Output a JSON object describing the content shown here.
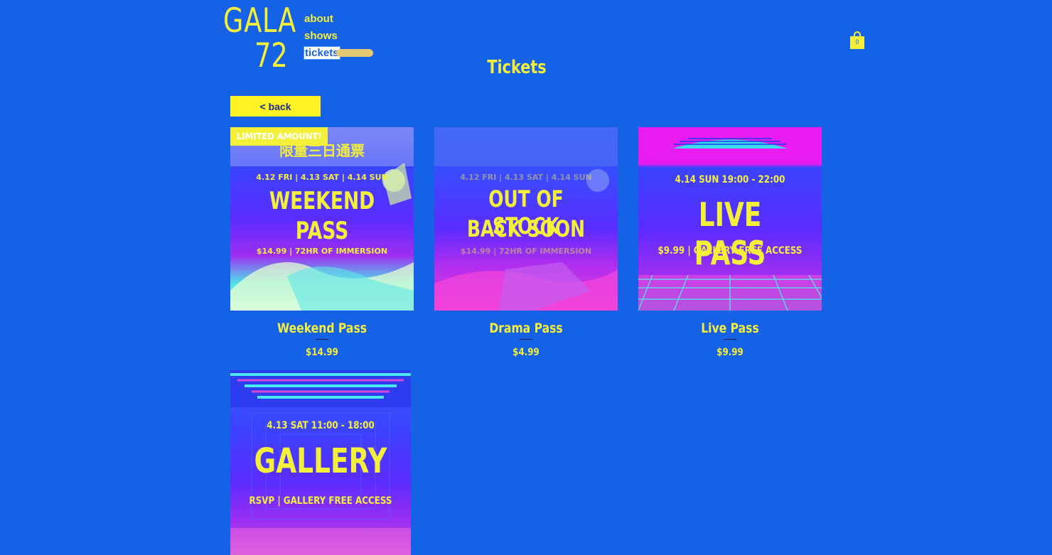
{
  "header": {
    "logo_line1": "GALA",
    "logo_line2": "72",
    "nav": [
      {
        "label": "about"
      },
      {
        "label": "shows"
      },
      {
        "label": "tickets"
      }
    ],
    "cart_count": "0"
  },
  "page_title": "Tickets",
  "back_label": "< back",
  "products": [
    {
      "name": "Weekend Pass",
      "price": "$14.99",
      "ribbon": "LIMITED AMOUNT!",
      "poster": {
        "subtitle": "限量三日通票",
        "dates": "4.12 FRI | 4.13 SAT | 4.14 SUN",
        "headline1": "WEEKEND",
        "headline2": "PASS",
        "tagline": "$14.99 | 72HR OF IMMERSION"
      }
    },
    {
      "name": "Drama Pass",
      "price": "$4.99",
      "poster": {
        "dates": "4.12 FRI | 4.13 SAT | 4.14 SUN",
        "headline1": "OUT OF STOCK",
        "headline2": "BACK SOON",
        "tagline": "$14.99 | 72HR OF IMMERSION"
      }
    },
    {
      "name": "Live Pass",
      "price": "$9.99",
      "poster": {
        "dates": "4.14 SUN 19:00 - 22:00",
        "headline1": "LIVE PASS",
        "tagline": "$9.99 | GALLERY FREE ACCESS"
      }
    },
    {
      "poster": {
        "dates": "4.13 SAT 11:00 - 18:00",
        "headline1": "GALLERY",
        "tagline": "RSVP | GALLERY FREE ACCESS"
      }
    }
  ],
  "colors": {
    "background": "#1662E6",
    "accent_yellow": "#F4F03A",
    "magenta": "#E81CF0",
    "cyan": "#2EE6E6"
  },
  "icons": {
    "cart": "shopping-bag-icon"
  }
}
